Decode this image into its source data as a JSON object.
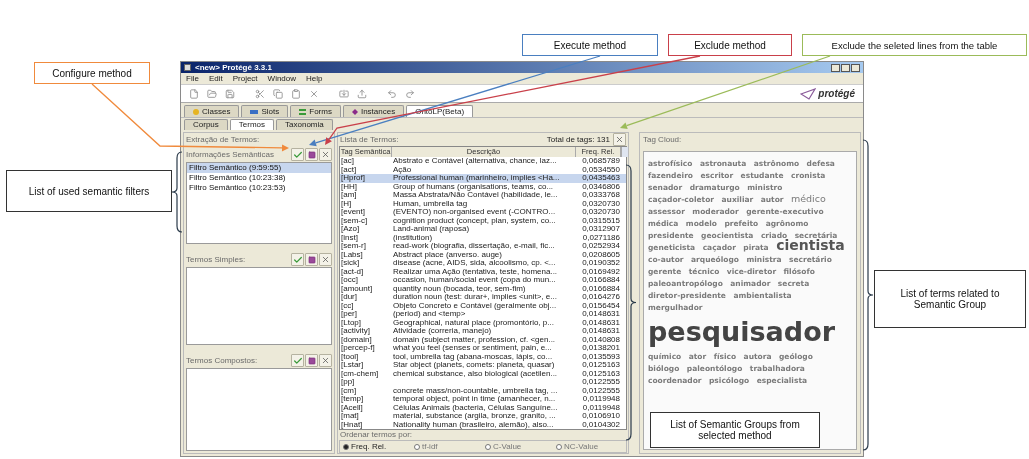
{
  "callouts": [
    {
      "text": "Configure method",
      "color": "#f08a3c"
    },
    {
      "text": "Execute method",
      "color": "#4a7fc0"
    },
    {
      "text": "Exclude method",
      "color": "#c9404a"
    },
    {
      "text": "Exclude the seleted lines from the table",
      "color": "#9bbb59"
    },
    {
      "text": "List of used semantic filters",
      "color": "#333333"
    },
    {
      "text": "List of Semantic Groups from selected method",
      "color": "#333333"
    },
    {
      "text": "List of terms related to Semantic Group",
      "color": "#333333"
    }
  ],
  "window": {
    "title": "<new>  Protégé 3.3.1",
    "menu": [
      "File",
      "Edit",
      "Project",
      "Window",
      "Help"
    ],
    "logo": "protégé",
    "tabs": [
      {
        "label": "Classes",
        "kind": "classes",
        "selected": false
      },
      {
        "label": "Slots",
        "kind": "slots",
        "selected": false
      },
      {
        "label": "Forms",
        "kind": "forms",
        "selected": false
      },
      {
        "label": "Instances",
        "kind": "instances",
        "selected": false
      },
      {
        "label": "OntoLP(Beta)",
        "kind": "plain",
        "selected": true
      }
    ],
    "subtabs": [
      {
        "label": "Corpus",
        "selected": false
      },
      {
        "label": "Termos",
        "selected": true
      },
      {
        "label": "Taxonomia",
        "selected": false
      }
    ]
  },
  "extraction": {
    "title": "Extração de Termos:",
    "panels": [
      {
        "title": "Informações Semânticas",
        "items": [
          {
            "label": "Filtro Semântico (9:59:55)",
            "selected": true
          },
          {
            "label": "Filtro Semântico (10:23:38)",
            "selected": false
          },
          {
            "label": "Filtro Semântico (10:23:53)",
            "selected": false
          }
        ]
      },
      {
        "title": "Termos Simples:"
      },
      {
        "title": "Termos Compostos:"
      }
    ]
  },
  "terms": {
    "title": "Lista de Termos:",
    "total": "Total de tags: 131",
    "columns": [
      "Tag Semântica",
      "Descrição",
      "Freq. Rel."
    ],
    "rows": [
      {
        "tag": "[ac]",
        "description": "Abstrato e Contável (alternativa, chance, laz...",
        "freq": "0,0685789",
        "selected": false
      },
      {
        "tag": "[act]",
        "description": "Ação",
        "freq": "0,0534550",
        "selected": false
      },
      {
        "tag": "[Hprof]",
        "description": "Professional human (marinheiro, implies <Ha...",
        "freq": "0,0435463",
        "selected": true
      },
      {
        "tag": "[HH]",
        "description": "Group of humans (organisations, teams, co...",
        "freq": "0,0346806",
        "selected": false
      },
      {
        "tag": "[am]",
        "description": "Massa Abstrata/Não Contável (habilidade, le...",
        "freq": "0,0333768",
        "selected": false
      },
      {
        "tag": "[H]",
        "description": "Human, umbrella tag",
        "freq": "0,0320730",
        "selected": false
      },
      {
        "tag": "[event]",
        "description": "(EVENTO) non-organised event (-CONTRO...",
        "freq": "0,0320730",
        "selected": false
      },
      {
        "tag": "[sem-c]",
        "description": "cognition product (concept, plan, system, co...",
        "freq": "0,0315515",
        "selected": false
      },
      {
        "tag": "[Azo]",
        "description": "Land-animal (raposa)",
        "freq": "0,0312907",
        "selected": false
      },
      {
        "tag": "[inst]",
        "description": "(institution)",
        "freq": "0,0271186",
        "selected": false
      },
      {
        "tag": "[sem-r]",
        "description": "read-work (biografia, dissertação, e-mail, fic...",
        "freq": "0,0252934",
        "selected": false
      },
      {
        "tag": "[Labs]",
        "description": "Abstract place (anverso. auge)",
        "freq": "0,0208605",
        "selected": false
      },
      {
        "tag": "[sick]",
        "description": "disease (acne, AIDS, sida, alcoolismo, cp. <...",
        "freq": "0,0190352",
        "selected": false
      },
      {
        "tag": "[act-d]",
        "description": "Realizar uma Ação (tentativa, teste, homena...",
        "freq": "0,0169492",
        "selected": false
      },
      {
        "tag": "[occ]",
        "description": "occasion, human/social event (copa do mun...",
        "freq": "0,0166884",
        "selected": false
      },
      {
        "tag": "[amount]",
        "description": "quantity noun (bocada, teor, sem-fim)",
        "freq": "0,0166884",
        "selected": false
      },
      {
        "tag": "[dur]",
        "description": "duration noun (test: durar+, implies <unit>, e...",
        "freq": "0,0164276",
        "selected": false
      },
      {
        "tag": "[cc]",
        "description": "Objeto Concreto e Contável (geralmente obj...",
        "freq": "0,0156454",
        "selected": false
      },
      {
        "tag": "[per]",
        "description": "(period) and <temp>",
        "freq": "0,0148631",
        "selected": false
      },
      {
        "tag": "[Ltop]",
        "description": "Geographical, natural place (promontório, p...",
        "freq": "0,0148631",
        "selected": false
      },
      {
        "tag": "[activity]",
        "description": "Atividade (correria, manejo)",
        "freq": "0,0148631",
        "selected": false
      },
      {
        "tag": "[domain]",
        "description": "domain (subject matter, profession, cf. <gen...",
        "freq": "0,0140808",
        "selected": false
      },
      {
        "tag": "[percep-f]",
        "description": "what you feel (senses or sentiment, pain, e...",
        "freq": "0,0138201",
        "selected": false
      },
      {
        "tag": "[tool]",
        "description": "tool, umbrella tag (abana-moscas, lápis, co...",
        "freq": "0,0135593",
        "selected": false
      },
      {
        "tag": "[Lstar]",
        "description": "Star object (planets, comets: planeta, quasar)",
        "freq": "0,0125163",
        "selected": false
      },
      {
        "tag": "[cm-chem]",
        "description": "chemical substance, also biological (acetilen...",
        "freq": "0,0125163",
        "selected": false
      },
      {
        "tag": "[pp]",
        "freq": "0,0122555",
        "selected": false
      },
      {
        "tag": "[cm]",
        "description": "concrete mass/non-countable, umbrella tag, ...",
        "freq": "0,0122555",
        "selected": false
      },
      {
        "tag": "[temp]",
        "description": "temporal object, point in time (amanhecer, n...",
        "freq": "0,0119948",
        "selected": false
      },
      {
        "tag": "[Acell]",
        "description": "Células Animais (bacteria, Células Sanguíne...",
        "freq": "0,0119948",
        "selected": false
      },
      {
        "tag": "[mat]",
        "description": "material, substance (argila, bronze, granito, ...",
        "freq": "0,0106910",
        "selected": false
      },
      {
        "tag": "[Hnat]",
        "description": "Nationality human (brasileiro, alemão), also...",
        "freq": "0,0104302",
        "selected": false
      }
    ],
    "sort_label": "Ordenar termos por:",
    "sort_options": [
      {
        "label": "Freq. Rel.",
        "selected": true
      },
      {
        "label": "tf-idf",
        "selected": false
      },
      {
        "label": "C-Value",
        "selected": false
      },
      {
        "label": "NC-Value",
        "selected": false
      }
    ]
  },
  "tag_cloud": {
    "title": "Tag Cloud:",
    "words": [
      {
        "text": "astrofísico",
        "kind": "normal"
      },
      {
        "text": "astronauta",
        "kind": "normal"
      },
      {
        "text": "astrônomo",
        "kind": "normal"
      },
      {
        "text": "defesa",
        "kind": "normal"
      },
      {
        "text": "fazendeiro",
        "kind": "normal"
      },
      {
        "text": "escritor",
        "kind": "normal"
      },
      {
        "text": "estudante",
        "kind": "normal"
      },
      {
        "text": "cronista",
        "kind": "normal"
      },
      {
        "text": "senador",
        "kind": "normal"
      },
      {
        "text": "dramaturgo",
        "kind": "normal"
      },
      {
        "text": "ministro",
        "kind": "normal"
      },
      {
        "text": "caçador-coletor",
        "kind": "normal"
      },
      {
        "text": "auxiliar",
        "kind": "normal"
      },
      {
        "text": "autor",
        "kind": "normal"
      },
      {
        "text": "médico",
        "kind": "medium"
      },
      {
        "text": "assessor",
        "kind": "normal"
      },
      {
        "text": "moderador",
        "kind": "normal"
      },
      {
        "text": "gerente-executivo",
        "kind": "normal"
      },
      {
        "text": "médica",
        "kind": "normal"
      },
      {
        "text": "modelo",
        "kind": "normal"
      },
      {
        "text": "prefeito",
        "kind": "normal"
      },
      {
        "text": "agrônomo",
        "kind": "normal"
      },
      {
        "text": "presidente",
        "kind": "normal"
      },
      {
        "text": "geocientista",
        "kind": "normal"
      },
      {
        "text": "criado",
        "kind": "normal"
      },
      {
        "text": "secretária",
        "kind": "normal"
      },
      {
        "text": "geneticista",
        "kind": "normal"
      },
      {
        "text": "caçador",
        "kind": "normal"
      },
      {
        "text": "pirata",
        "kind": "normal"
      },
      {
        "text": "cientista",
        "kind": "large"
      },
      {
        "text": "co-autor",
        "kind": "normal"
      },
      {
        "text": "arqueólogo",
        "kind": "normal"
      },
      {
        "text": "ministra",
        "kind": "normal"
      },
      {
        "text": "secretário",
        "kind": "normal"
      },
      {
        "text": "gerente",
        "kind": "normal"
      },
      {
        "text": "técnico",
        "kind": "normal"
      },
      {
        "text": "vice-diretor",
        "kind": "normal"
      },
      {
        "text": "filósofo",
        "kind": "normal"
      },
      {
        "text": "paleoantropólogo",
        "kind": "normal"
      },
      {
        "text": "animador",
        "kind": "normal"
      },
      {
        "text": "secreta",
        "kind": "normal"
      },
      {
        "text": "diretor-presidente",
        "kind": "normal"
      },
      {
        "text": "ambientalista",
        "kind": "normal"
      },
      {
        "text": "mergulhador",
        "kind": "normal"
      },
      {
        "text": "pesquisador",
        "kind": "huge"
      },
      {
        "text": "químico",
        "kind": "normal"
      },
      {
        "text": "ator",
        "kind": "normal"
      },
      {
        "text": "físico",
        "kind": "normal"
      },
      {
        "text": "autora",
        "kind": "normal"
      },
      {
        "text": "geólogo",
        "kind": "normal"
      },
      {
        "text": "biólogo",
        "kind": "normal"
      },
      {
        "text": "paleontólogo",
        "kind": "normal"
      },
      {
        "text": "trabalhadora",
        "kind": "normal"
      },
      {
        "text": "coordenador",
        "kind": "normal"
      },
      {
        "text": "psicólogo",
        "kind": "normal"
      },
      {
        "text": "especialista",
        "kind": "normal"
      }
    ]
  }
}
